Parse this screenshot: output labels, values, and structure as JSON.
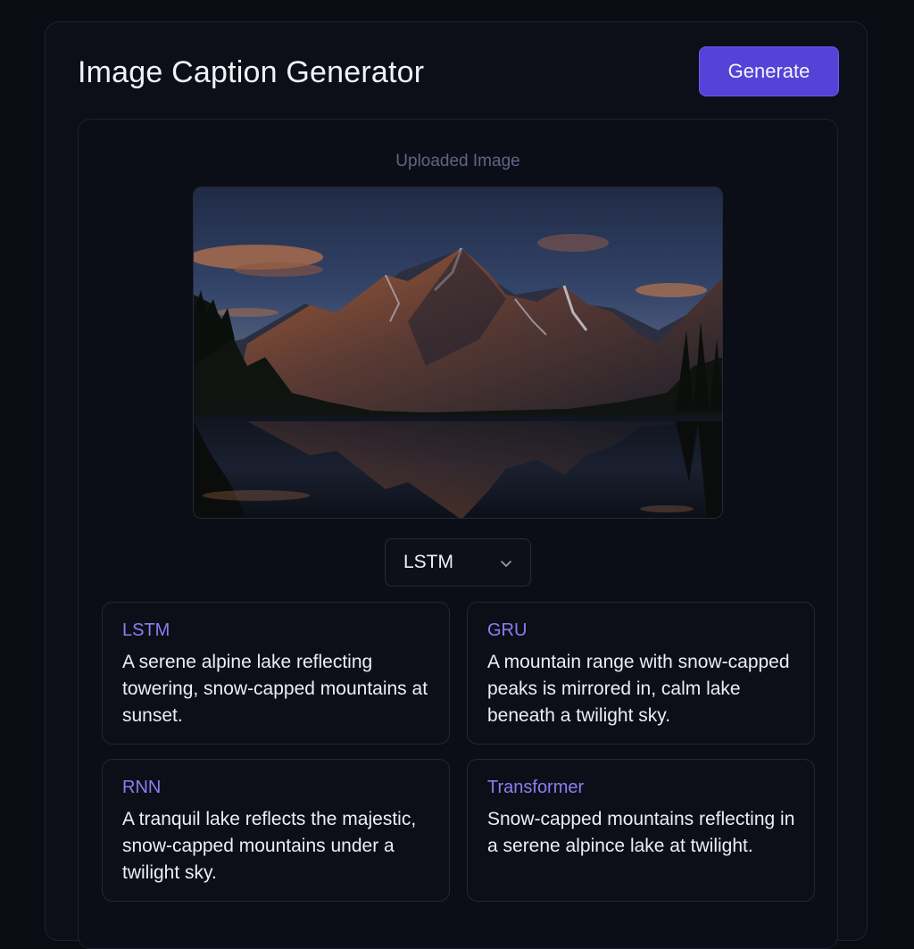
{
  "header": {
    "title": "Image Caption Generator",
    "generate_label": "Generate"
  },
  "upload": {
    "label": "Uploaded Image",
    "image_icon": "mountain-lake-photo"
  },
  "model_select": {
    "selected": "LSTM",
    "icon": "chevron-down-icon"
  },
  "captions": [
    {
      "model": "LSTM",
      "text": "A serene alpine lake reflecting towering, snow-capped mountains at sunset."
    },
    {
      "model": "GRU",
      "text": "A mountain range with snow-capped peaks is mirrored in, calm lake beneath a twilight sky."
    },
    {
      "model": "RNN",
      "text": "A tranquil lake reflects the majestic, snow-capped mountains under a twilight sky."
    },
    {
      "model": "Transformer",
      "text": "Snow-capped mountains reflecting in a serene alpince lake at twilight."
    }
  ],
  "colors": {
    "accent": "#5443d6",
    "model_label": "#8b7df2",
    "background": "#0a0c14"
  }
}
